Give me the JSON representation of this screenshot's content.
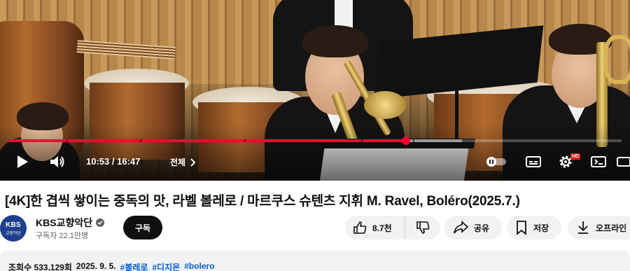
{
  "player": {
    "current_time": "10:53",
    "duration": "16:47",
    "time_separator": "/",
    "chapter_label": "전체",
    "quality_badge": "HD",
    "progress_fraction": 0.648,
    "buffered_fraction": 0.74,
    "chapter_gap_fractions": [
      0.095,
      0.215,
      0.385,
      0.575,
      0.66
    ],
    "accent_color": "#ff0033",
    "controls": {
      "play": "play-icon",
      "volume": "volume-icon",
      "autoplay": "autoplay-toggle-icon",
      "subtitles": "subtitles-icon",
      "settings": "gear-icon",
      "miniplayer": "miniplayer-icon",
      "theater": "theater-icon"
    }
  },
  "video": {
    "title": "[4K]한 겹씩 쌓이는 중독의 맛, 라벨 볼레로 / 마르쿠스 슈텐츠 지휘 M. Ravel, Boléro(2025.7.)"
  },
  "channel": {
    "avatar_text_top": "KBS",
    "avatar_text_bottom": "교향악단",
    "avatar_color": "#1c3f8f",
    "name": "KBS교향악단",
    "subscribers": "구독자 22.1만명",
    "verified_icon": "verified-check-icon"
  },
  "actions": {
    "subscribe_label": "구독",
    "like_count": "8.7천",
    "share_label": "공유",
    "save_label": "저장",
    "download_label": "오프라인"
  },
  "description": {
    "views": "조회수 533,129회",
    "date": "2025. 9. 5.",
    "hashtags": [
      "#볼레로",
      "#디지몬",
      "#bolero"
    ],
    "link_color": "#065fd4"
  }
}
